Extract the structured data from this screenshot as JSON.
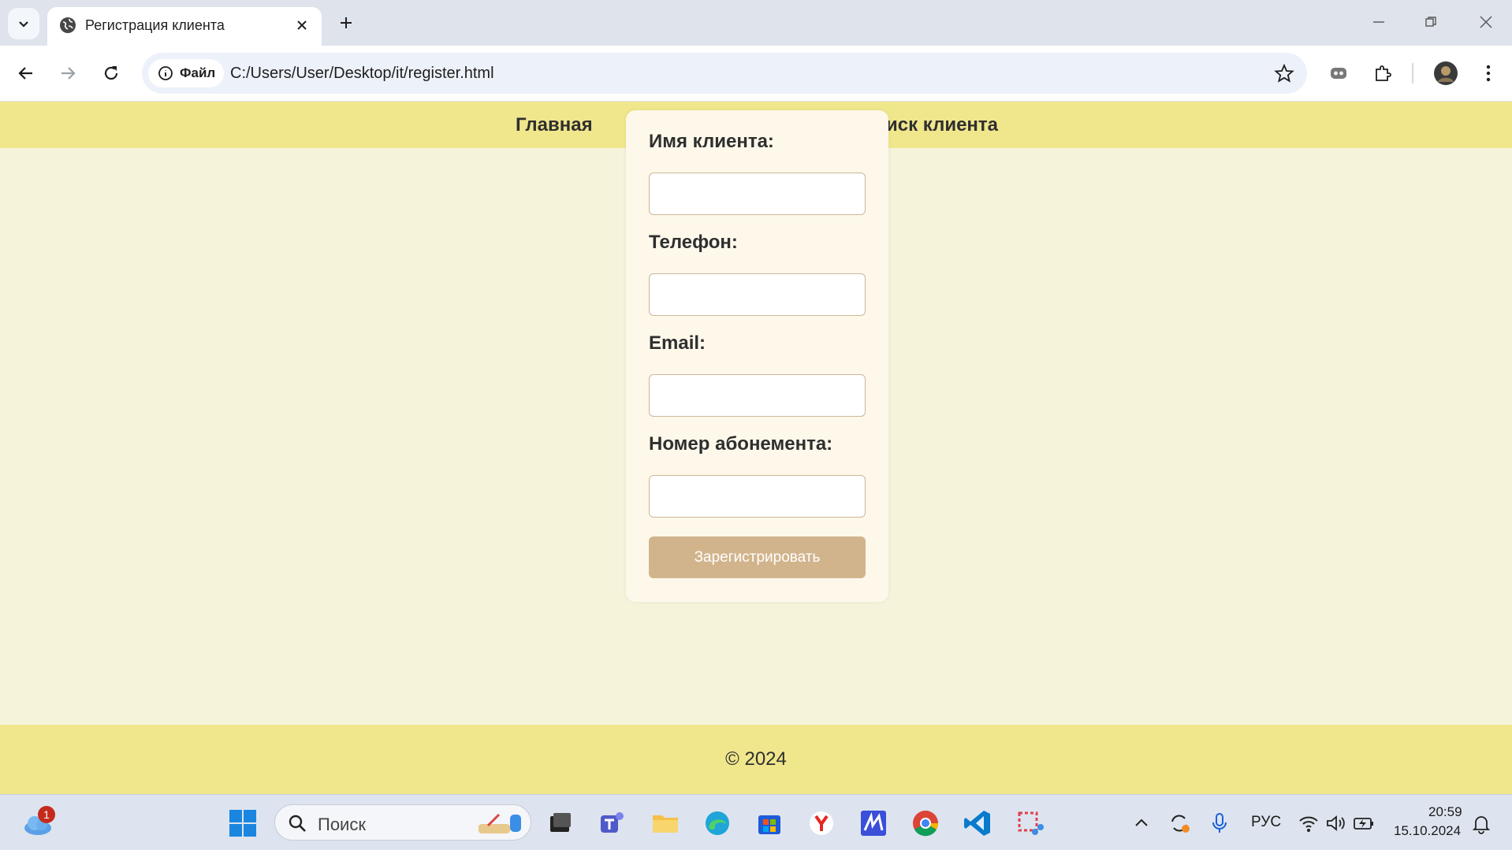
{
  "browser": {
    "tab_title": "Регистрация клиента",
    "omnibox_chip": "Файл",
    "url": "C:/Users/User/Desktop/it/register.html"
  },
  "nav": {
    "home": "Главная",
    "search": "иск клиента"
  },
  "form": {
    "name_label": "Имя клиента:",
    "name_value": "",
    "phone_label": "Телефон:",
    "phone_value": "",
    "email_label": "Email:",
    "email_value": "",
    "membership_label": "Номер абонемента:",
    "membership_value": "",
    "submit_label": "Зарегистрировать"
  },
  "footer": {
    "copyright": "© 2024"
  },
  "taskbar": {
    "weather_badge": "1",
    "search_placeholder": "Поиск",
    "language": "РУС",
    "time": "20:59",
    "date": "15.10.2024"
  },
  "colors": {
    "navbar": "#f0e68c",
    "page_bg": "#f5f3da",
    "card_bg": "#fdf8ea",
    "button": "#d2b48c"
  }
}
